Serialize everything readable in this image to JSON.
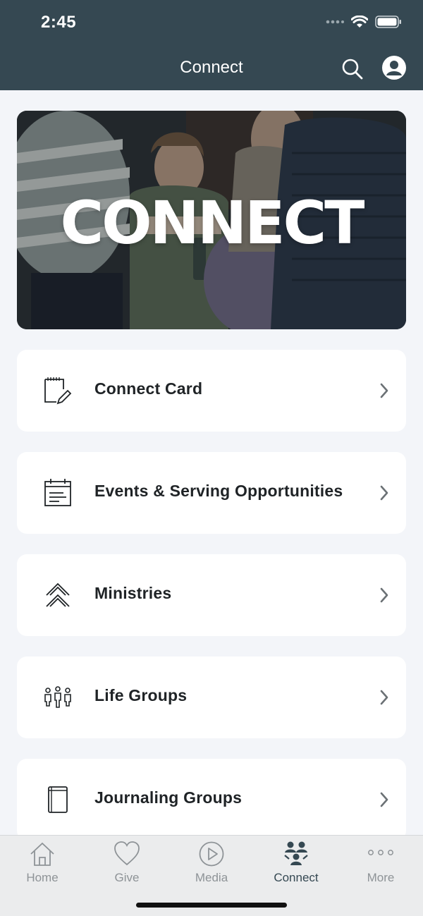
{
  "status": {
    "time": "2:45"
  },
  "nav": {
    "title": "Connect"
  },
  "hero": {
    "text": "CONNECT"
  },
  "menu": [
    {
      "label": "Connect Card",
      "icon": "note-pencil-icon"
    },
    {
      "label": "Events & Serving Opportunities",
      "icon": "calendar-icon"
    },
    {
      "label": "Ministries",
      "icon": "double-chevron-up-icon"
    },
    {
      "label": "Life Groups",
      "icon": "people-group-icon"
    },
    {
      "label": "Journaling Groups",
      "icon": "book-icon"
    }
  ],
  "tabs": [
    {
      "label": "Home",
      "icon": "home-icon"
    },
    {
      "label": "Give",
      "icon": "heart-icon"
    },
    {
      "label": "Media",
      "icon": "play-circle-icon"
    },
    {
      "label": "Connect",
      "icon": "people-icon",
      "active": true
    },
    {
      "label": "More",
      "icon": "more-dots-icon"
    }
  ],
  "colors": {
    "header": "#354852",
    "background": "#f3f5f9",
    "tab_active": "#354852",
    "tab_inactive": "#8e9397"
  }
}
